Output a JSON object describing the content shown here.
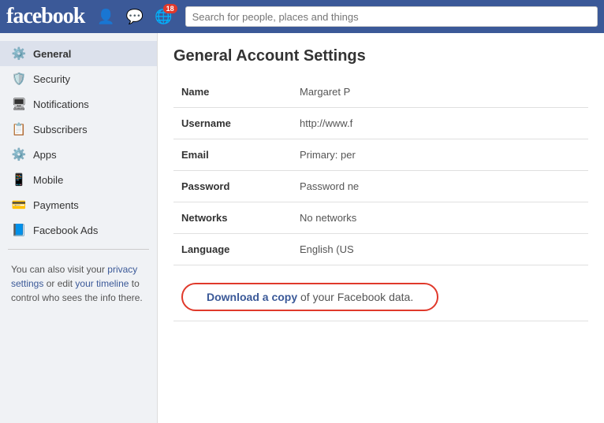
{
  "topbar": {
    "logo": "facebook",
    "notification_count": "18",
    "search_placeholder": "Search for people, places and things"
  },
  "sidebar": {
    "items": [
      {
        "id": "general",
        "label": "General",
        "icon": "⚙",
        "active": true
      },
      {
        "id": "security",
        "label": "Security",
        "icon": "🛡",
        "active": false
      },
      {
        "id": "notifications",
        "label": "Notifications",
        "icon": "🖥",
        "active": false
      },
      {
        "id": "subscribers",
        "label": "Subscribers",
        "icon": "📋",
        "active": false
      },
      {
        "id": "apps",
        "label": "Apps",
        "icon": "⚙",
        "active": false
      },
      {
        "id": "mobile",
        "label": "Mobile",
        "icon": "📱",
        "active": false
      },
      {
        "id": "payments",
        "label": "Payments",
        "icon": "💳",
        "active": false
      },
      {
        "id": "facebook-ads",
        "label": "Facebook Ads",
        "icon": "📘",
        "active": false
      }
    ],
    "footer_text_1": "You can also visit your ",
    "footer_link_privacy": "privacy settings",
    "footer_text_2": " or edit ",
    "footer_link_timeline": "your timeline",
    "footer_text_3": " to control who sees the info there."
  },
  "content": {
    "page_title": "General Account Settings",
    "settings": [
      {
        "label": "Name",
        "value": "Margaret P"
      },
      {
        "label": "Username",
        "value": "http://www.f"
      },
      {
        "label": "Email",
        "value": "Primary: per"
      },
      {
        "label": "Password",
        "value": "Password ne"
      },
      {
        "label": "Networks",
        "value": "No networks"
      },
      {
        "label": "Language",
        "value": "English (US"
      }
    ],
    "download_prefix": "Download a copy",
    "download_suffix": " of your Facebook data."
  }
}
